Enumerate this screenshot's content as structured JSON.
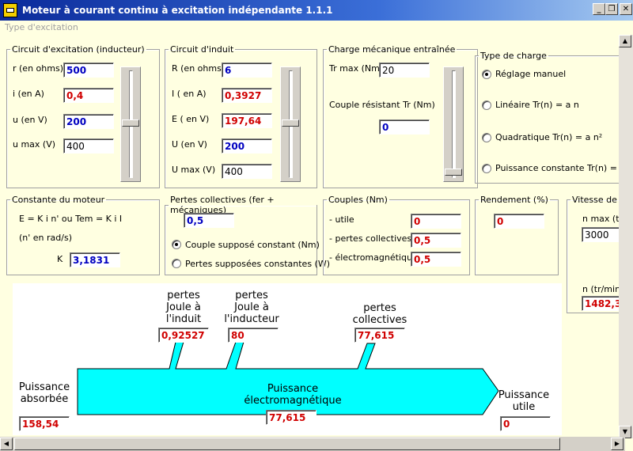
{
  "window": {
    "title": "Moteur à courant continu à excitation indépendante   1.1.1"
  },
  "menu": {
    "label": "Type d'excitation"
  },
  "excitation": {
    "legend": "Circuit d'excitation (inducteur)",
    "r_label": "r (en ohms)",
    "r_value": "500",
    "i_label": "i (en A)",
    "i_value": "0,4",
    "u_label": "u (en V)",
    "u_value": "200",
    "umax_label": "u max (V)",
    "umax_value": "400"
  },
  "induit": {
    "legend": "Circuit d'induit",
    "R_label": "R (en ohms)",
    "R_value": "6",
    "I_label": "I ( en A)",
    "I_value": "0,3927",
    "E_label": "E ( en V)",
    "E_value": "197,64",
    "U_label": "U (en V)",
    "U_value": "200",
    "Umax_label": "U max (V)",
    "Umax_value": "400"
  },
  "charge": {
    "legend": "Charge mécanique entraînée",
    "trmax_label": "Tr max (Nm)",
    "trmax_value": "20",
    "couple_label": "Couple résistant Tr (Nm)",
    "couple_value": "0"
  },
  "type_charge": {
    "legend": "Type de charge",
    "options": [
      "Réglage manuel",
      "Linéaire Tr(n) = a n",
      "Quadratique Tr(n) = a n²",
      "Puissance constante Tr(n) = a / n"
    ]
  },
  "constante": {
    "legend": "Constante du moteur",
    "eq": "E = K i n'    ou    Tem = K i I",
    "unit": "(n' en rad/s)",
    "K_label": "K",
    "K_value": "3,1831"
  },
  "pertes": {
    "legend": "Pertes collectives (fer + mécaniques)",
    "value": "0,5",
    "opt1": "Couple supposé constant (Nm)",
    "opt2": "Pertes supposées constantes (W)"
  },
  "couples": {
    "legend": "Couples (Nm)",
    "utile_label": "- utile",
    "utile_value": "0",
    "pc_label": "- pertes collectives",
    "pc_value": "0,5",
    "em_label": "- électromagnétique",
    "em_value": "0,5"
  },
  "rendement": {
    "legend": "Rendement (%)",
    "value": "0"
  },
  "vitesse": {
    "legend": "Vitesse de r",
    "nmax_label": "n max (tr/r",
    "nmax_value": "3000",
    "n_label": "n (tr/min)",
    "n_value": "1482,3"
  },
  "diagram": {
    "pj_induit_label": "pertes\nJoule à\nl'induit",
    "pj_induit_value": "0,92527",
    "pj_inducteur_label": "pertes\nJoule à\nl'inducteur",
    "pj_inducteur_value": "80",
    "pc_label": "pertes\ncollectives",
    "pc_value": "77,615",
    "absorbee_label": "Puissance\nabsorbée",
    "absorbee_value": "158,54",
    "em_label": "Puissance\nélectromagnétique",
    "em_value": "77,615",
    "utile_label": "Puissance\nutile",
    "utile_value": "0",
    "arrow_color": "#00ffff"
  }
}
